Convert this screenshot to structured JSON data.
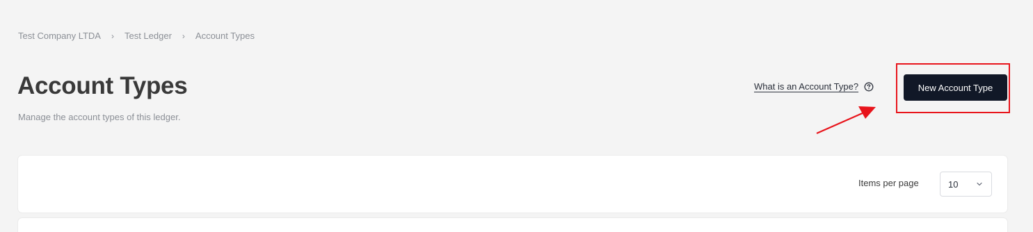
{
  "breadcrumb": {
    "items": [
      "Test Company LTDA",
      "Test Ledger",
      "Account Types"
    ],
    "separator": "›"
  },
  "header": {
    "title": "Account Types",
    "subtitle": "Manage the account types of this ledger.",
    "help_link": "What is an Account Type?",
    "help_icon": "question-circle-icon",
    "primary_button": "New Account Type"
  },
  "pagination": {
    "label": "Items per page",
    "selected": "10",
    "dropdown_icon": "chevron-down-icon"
  },
  "colors": {
    "background": "#f4f4f4",
    "primary_button": "#111827",
    "annotation": "#e8141b",
    "card": "#ffffff"
  }
}
